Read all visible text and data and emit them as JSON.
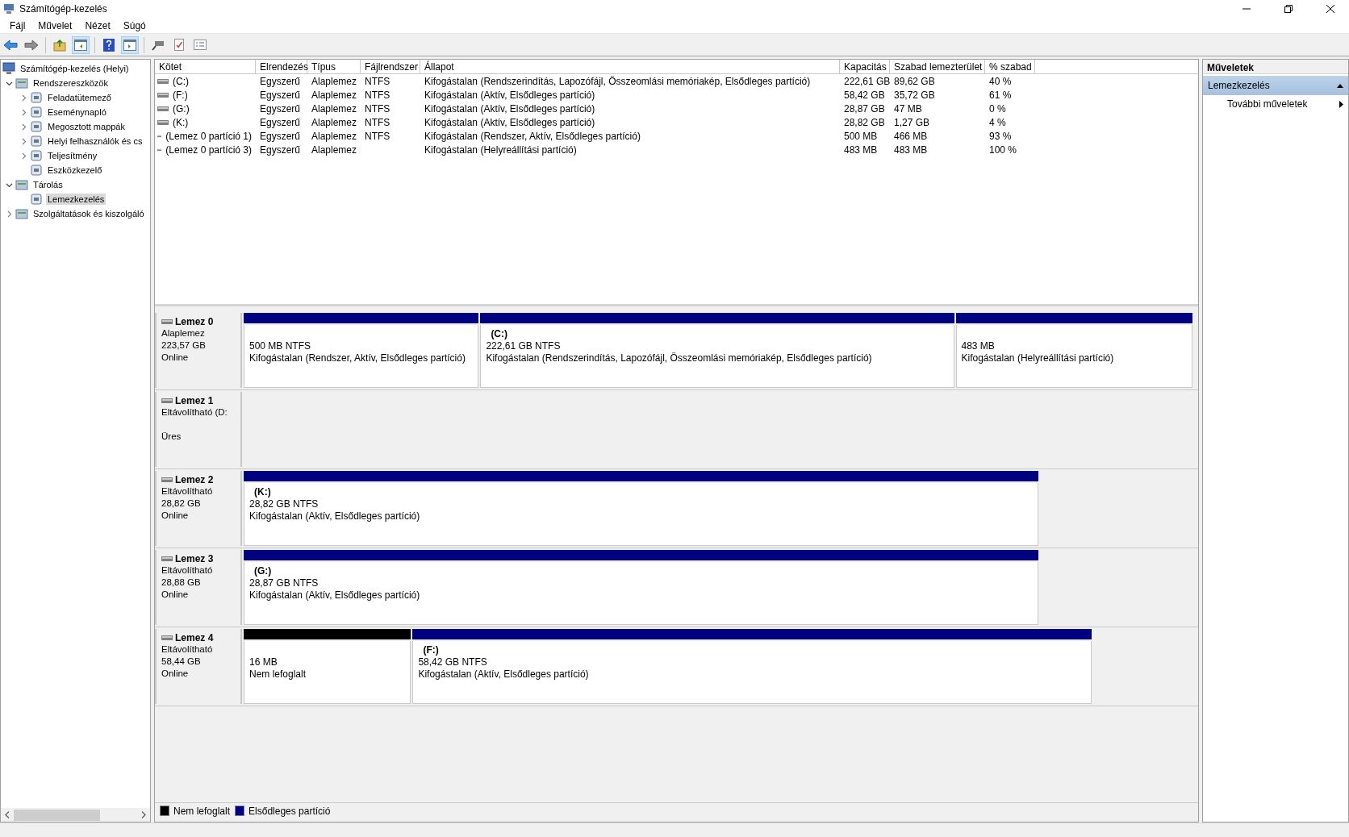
{
  "window": {
    "title": "Számítógép-kezelés"
  },
  "menu": [
    "Fájl",
    "Művelet",
    "Nézet",
    "Súgó"
  ],
  "tree": [
    {
      "label": "Számítógép-kezelés (Helyi)",
      "selected": false,
      "children": [
        {
          "label": "Rendszereszközök",
          "expanded": true,
          "selected": false,
          "children": [
            {
              "label": "Feladatütemező",
              "expanded": false,
              "selected": false
            },
            {
              "label": "Eseménynapló",
              "expanded": false,
              "selected": false
            },
            {
              "label": "Megosztott mappák",
              "expanded": false,
              "selected": false
            },
            {
              "label": "Helyi felhasználók és cs",
              "expanded": false,
              "selected": false
            },
            {
              "label": "Teljesítmény",
              "expanded": false,
              "selected": false
            },
            {
              "label": "Eszközkezelő",
              "selected": false
            }
          ]
        },
        {
          "label": "Tárolás",
          "expanded": true,
          "selected": false,
          "children": [
            {
              "label": "Lemezkezelés",
              "selected": true
            }
          ]
        },
        {
          "label": "Szolgáltatások és kiszolgáló",
          "expanded": false,
          "selected": false
        }
      ]
    }
  ],
  "volumes_table": {
    "columns": [
      "Kötet",
      "Elrendezés",
      "Típus",
      "Fájlrendszer",
      "Állapot",
      "Kapacitás",
      "Szabad lemezterület",
      "% szabad"
    ],
    "rows": [
      {
        "volume": "(C:)",
        "layout": "Egyszerű",
        "type": "Alaplemez",
        "filesystem": "NTFS",
        "status": "Kifogástalan (Rendszerindítás, Lapozófájl, Összeomlási memóriakép, Elsődleges partíció)",
        "capacity": "222,61 GB",
        "free": "89,62 GB",
        "percent": "40 %"
      },
      {
        "volume": "(F:)",
        "layout": "Egyszerű",
        "type": "Alaplemez",
        "filesystem": "NTFS",
        "status": "Kifogástalan (Aktív, Elsődleges partíció)",
        "capacity": "58,42 GB",
        "free": "35,72 GB",
        "percent": "61 %"
      },
      {
        "volume": "(G:)",
        "layout": "Egyszerű",
        "type": "Alaplemez",
        "filesystem": "NTFS",
        "status": "Kifogástalan (Aktív, Elsődleges partíció)",
        "capacity": "28,87 GB",
        "free": "47 MB",
        "percent": "0 %"
      },
      {
        "volume": "(K:)",
        "layout": "Egyszerű",
        "type": "Alaplemez",
        "filesystem": "NTFS",
        "status": "Kifogástalan (Aktív, Elsődleges partíció)",
        "capacity": "28,82 GB",
        "free": "1,27 GB",
        "percent": "4 %"
      },
      {
        "volume": "(Lemez 0 partíció 1)",
        "layout": "Egyszerű",
        "type": "Alaplemez",
        "filesystem": "NTFS",
        "status": "Kifogástalan (Rendszer, Aktív, Elsődleges partíció)",
        "capacity": "500 MB",
        "free": "466 MB",
        "percent": "93 %"
      },
      {
        "volume": "(Lemez 0 partíció 3)",
        "layout": "Egyszerű",
        "type": "Alaplemez",
        "status": "Kifogástalan (Helyreállítási partíció)",
        "capacity": "483 MB",
        "free": "483 MB",
        "percent": "100 %"
      }
    ]
  },
  "disks": [
    {
      "name": "Lemez 0",
      "type": "Alaplemez",
      "size": "223,57 GB",
      "status": "Online",
      "partitions": [
        {
          "kind": "primary",
          "size": "500 MB NTFS",
          "status": "Kifogástalan (Rendszer, Aktív, Elsődleges partíció)"
        },
        {
          "kind": "primary",
          "drive": "(C:)",
          "size": "222,61 GB NTFS",
          "status": "Kifogástalan (Rendszerindítás, Lapozófájl, Összeomlási memóriakép, Elsődleges partíció)"
        },
        {
          "kind": "primary",
          "size": "483 MB",
          "status": "Kifogástalan (Helyreállítási partíció)"
        }
      ]
    },
    {
      "name": "Lemez 1",
      "type": "Eltávolítható (D:",
      "status": "Üres"
    },
    {
      "name": "Lemez 2",
      "type": "Eltávolítható",
      "size": "28,82 GB",
      "status": "Online",
      "partitions": [
        {
          "kind": "primary",
          "drive": "(K:)",
          "size": "28,82 GB NTFS",
          "status": "Kifogástalan (Aktív, Elsődleges partíció)"
        }
      ]
    },
    {
      "name": "Lemez 3",
      "type": "Eltávolítható",
      "size": "28,88 GB",
      "status": "Online",
      "partitions": [
        {
          "kind": "primary",
          "drive": "(G:)",
          "size": "28,87 GB NTFS",
          "status": "Kifogástalan (Aktív, Elsődleges partíció)"
        }
      ]
    },
    {
      "name": "Lemez 4",
      "type": "Eltávolítható",
      "size": "58,44 GB",
      "status": "Online",
      "partitions": [
        {
          "kind": "unallocated",
          "size": "16 MB",
          "status": "Nem lefoglalt"
        },
        {
          "kind": "primary",
          "drive": "(F:)",
          "size": "58,42 GB NTFS",
          "status": "Kifogástalan (Aktív, Elsődleges partíció)"
        }
      ]
    }
  ],
  "legend": [
    {
      "label": "Nem lefoglalt",
      "color": "#000000"
    },
    {
      "label": "Elsődleges partíció",
      "color": "#000080"
    }
  ],
  "actions": {
    "title": "Műveletek",
    "section": {
      "label": "Lemezkezelés",
      "expanded": true
    },
    "items": [
      "További műveletek"
    ]
  }
}
